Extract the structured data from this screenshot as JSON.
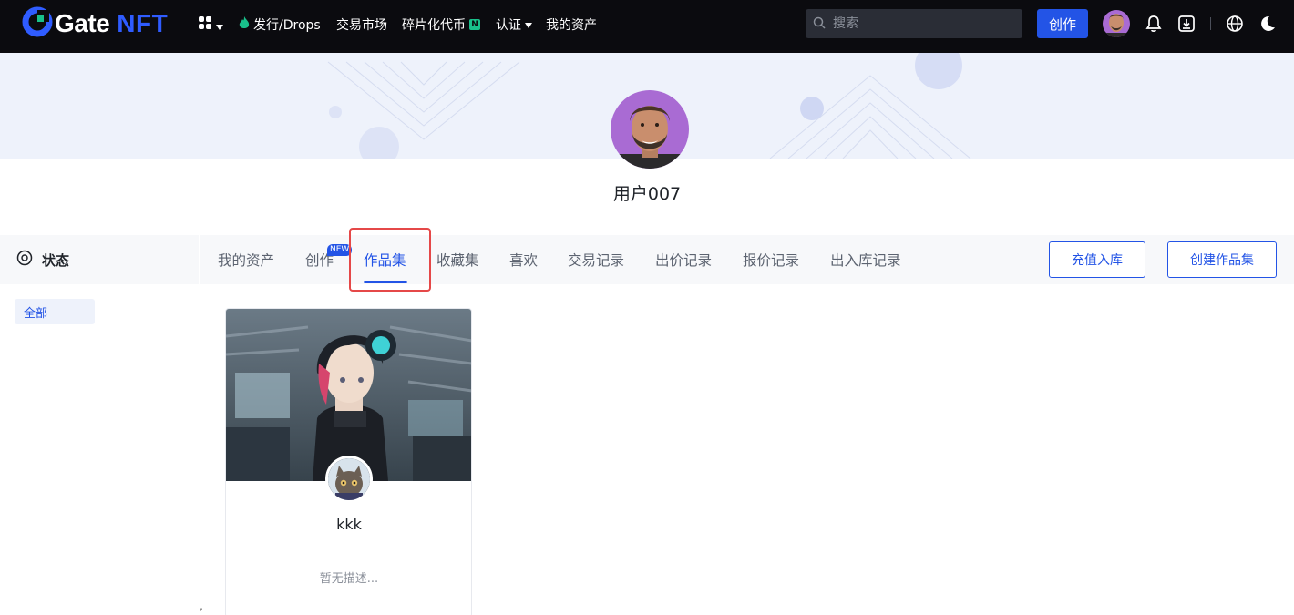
{
  "nav": {
    "logo_text": "Gate",
    "logo_nft": "NFT",
    "items": [
      {
        "label": "发行/Drops"
      },
      {
        "label": "交易市场"
      },
      {
        "label": "碎片化代币",
        "badge": "N"
      },
      {
        "label": "认证"
      },
      {
        "label": "我的资产"
      }
    ],
    "search_placeholder": "搜索",
    "create_label": "创作"
  },
  "profile": {
    "username": "用户007"
  },
  "sidebar": {
    "title": "状态",
    "filter_all": "全部"
  },
  "tabs": [
    {
      "label": "我的资产"
    },
    {
      "label": "创作",
      "badge": "NEW"
    },
    {
      "label": "作品集",
      "active": true
    },
    {
      "label": "收藏集"
    },
    {
      "label": "喜欢"
    },
    {
      "label": "交易记录"
    },
    {
      "label": "出价记录"
    },
    {
      "label": "报价记录"
    },
    {
      "label": "出入库记录"
    }
  ],
  "actions": {
    "deposit_label": "充值入库",
    "create_collection_label": "创建作品集"
  },
  "collection_card": {
    "name": "kkk",
    "description": "暂无描述..."
  },
  "misc": {
    "stray_mark": ","
  },
  "colors": {
    "accent": "#2354e6",
    "nav_bg": "#0b0b0f",
    "highlight_box": "#e54848",
    "new_badge": "#2354e6",
    "n_badge": "#19c08b"
  },
  "icons": [
    "gate-logo-icon",
    "apps-grid-icon",
    "chevron-down-icon",
    "flame-icon",
    "search-icon",
    "bell-icon",
    "download-icon",
    "globe-icon",
    "theme-toggle-icon",
    "status-target-icon"
  ]
}
